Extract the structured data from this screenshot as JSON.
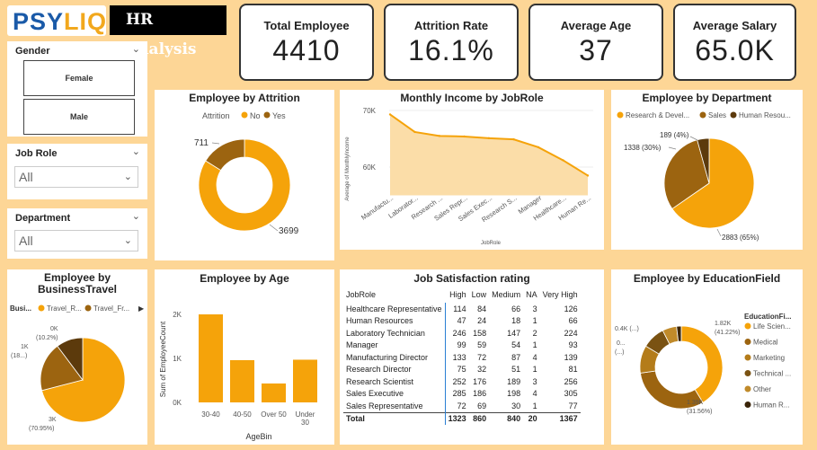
{
  "header": {
    "logo_text_part1": "PSY",
    "logo_text_part2": "LIQ",
    "title": "HR Analysis"
  },
  "kpis": [
    {
      "label": "Total Employee",
      "value": "4410"
    },
    {
      "label": "Attrition Rate",
      "value": "16.1%"
    },
    {
      "label": "Average Age",
      "value": "37"
    },
    {
      "label": "Average Salary",
      "value": "65.0K"
    }
  ],
  "slicers": {
    "gender": {
      "title": "Gender",
      "options": [
        "Female",
        "Male"
      ]
    },
    "job_role": {
      "title": "Job Role",
      "value": "All"
    },
    "department": {
      "title": "Department",
      "value": "All"
    }
  },
  "colors": {
    "primary": "#F5A30A",
    "secondary": "#9C6410",
    "dark": "#5C3A0C",
    "background": "#FDD696"
  },
  "attrition": {
    "title": "Employee by Attrition",
    "legend_title": "Attrition",
    "legend": [
      "No",
      "Yes"
    ],
    "labels": {
      "no": "3699",
      "yes": "711"
    }
  },
  "income": {
    "title": "Monthly Income by JobRole",
    "ylabel": "Average of MonthlyIncome",
    "xlabel": "JobRole",
    "yticks": [
      "70K",
      "60K"
    ],
    "categories": [
      "Manufactu...",
      "Laborator...",
      "Research ...",
      "Sales Repr...",
      "Sales Exec...",
      "Research S...",
      "Manager",
      "Healthcare...",
      "Human Re..."
    ]
  },
  "department": {
    "title": "Employee by Department",
    "legend": [
      "Research & Devel...",
      "Sales",
      "Human Resou..."
    ],
    "labels": {
      "rd": "2883 (65%)",
      "sales": "1338 (30%)",
      "hr": "189 (4%)"
    }
  },
  "travel": {
    "title_line1": "Employee by",
    "title_line2": "BusinessTravel",
    "legend_title": "Busi...",
    "legend": [
      "Travel_R...",
      "Travel_Fr..."
    ],
    "labels": {
      "big": "3K",
      "big_pct": "(70.95%)",
      "mid": "1K",
      "mid_pct": "(18...)",
      "small": "0K",
      "small_pct": "(10.2%)"
    }
  },
  "age": {
    "title": "Employee by Age",
    "ylabel": "Sum of EmployeeCount",
    "xlabel": "AgeBin",
    "yticks": [
      "2K",
      "1K",
      "0K"
    ],
    "categories": [
      "30-40",
      "40-50",
      "Over 50",
      "Under 30"
    ]
  },
  "job_satisfaction": {
    "title": "Job Satisfaction rating",
    "columns": [
      "JobRole",
      "High",
      "Low",
      "Medium",
      "NA",
      "Very High"
    ],
    "rows": [
      [
        "Healthcare Representative",
        "114",
        "84",
        "66",
        "3",
        "126"
      ],
      [
        "Human Resources",
        "47",
        "24",
        "18",
        "1",
        "66"
      ],
      [
        "Laboratory Technician",
        "246",
        "158",
        "147",
        "2",
        "224"
      ],
      [
        "Manager",
        "99",
        "59",
        "54",
        "1",
        "93"
      ],
      [
        "Manufacturing Director",
        "133",
        "72",
        "87",
        "4",
        "139"
      ],
      [
        "Research Director",
        "75",
        "32",
        "51",
        "1",
        "81"
      ],
      [
        "Research Scientist",
        "252",
        "176",
        "189",
        "3",
        "256"
      ],
      [
        "Sales Executive",
        "285",
        "186",
        "198",
        "4",
        "305"
      ],
      [
        "Sales Representative",
        "72",
        "69",
        "30",
        "1",
        "77"
      ]
    ],
    "total": [
      "Total",
      "1323",
      "860",
      "840",
      "20",
      "1367"
    ]
  },
  "education": {
    "title": "Employee by EducationField",
    "legend_title": "EducationFi...",
    "legend": [
      "Life Scien...",
      "Medical",
      "Marketing",
      "Technical ...",
      "Other",
      "Human R..."
    ],
    "labels": {
      "life": "1.82K",
      "life_pct": "(41.22%)",
      "medical": "1.39K",
      "medical_pct": "(31.56%)",
      "small1": "0.4K (...)",
      "small2": "0...",
      "small2_pct": "(...)"
    }
  },
  "chart_data": [
    {
      "type": "pie",
      "title": "Employee by Attrition",
      "categories": [
        "No",
        "Yes"
      ],
      "values": [
        3699,
        711
      ]
    },
    {
      "type": "area",
      "title": "Monthly Income by JobRole",
      "xlabel": "JobRole",
      "ylabel": "Average of MonthlyIncome",
      "categories": [
        "Manufactu...",
        "Laborator...",
        "Research ...",
        "Sales Repr...",
        "Sales Exec...",
        "Research S...",
        "Manager",
        "Healthcare...",
        "Human Re..."
      ],
      "values": [
        69300,
        66200,
        65500,
        65400,
        65100,
        64900,
        63500,
        61200,
        58500
      ],
      "ylim": [
        55000,
        72000
      ]
    },
    {
      "type": "pie",
      "title": "Employee by Department",
      "categories": [
        "Research & Devel...",
        "Sales",
        "Human Resou..."
      ],
      "values": [
        2883,
        1338,
        189
      ]
    },
    {
      "type": "pie",
      "title": "Employee by BusinessTravel",
      "categories": [
        "Travel_R...",
        "Travel_Fr...",
        ""
      ],
      "values": [
        3129,
        831,
        450
      ]
    },
    {
      "type": "bar",
      "title": "Employee by Age",
      "xlabel": "AgeBin",
      "ylabel": "Sum of EmployeeCount",
      "categories": [
        "30-40",
        "40-50",
        "Over 50",
        "Under 30"
      ],
      "values": [
        2000,
        960,
        430,
        970
      ],
      "ylim": [
        0,
        2300
      ]
    },
    {
      "type": "pie",
      "title": "Employee by EducationField",
      "categories": [
        "Life Scien...",
        "Medical",
        "Marketing",
        "Technical ...",
        "Other",
        "Human R..."
      ],
      "values": [
        1818,
        1392,
        477,
        396,
        246,
        81
      ]
    }
  ]
}
